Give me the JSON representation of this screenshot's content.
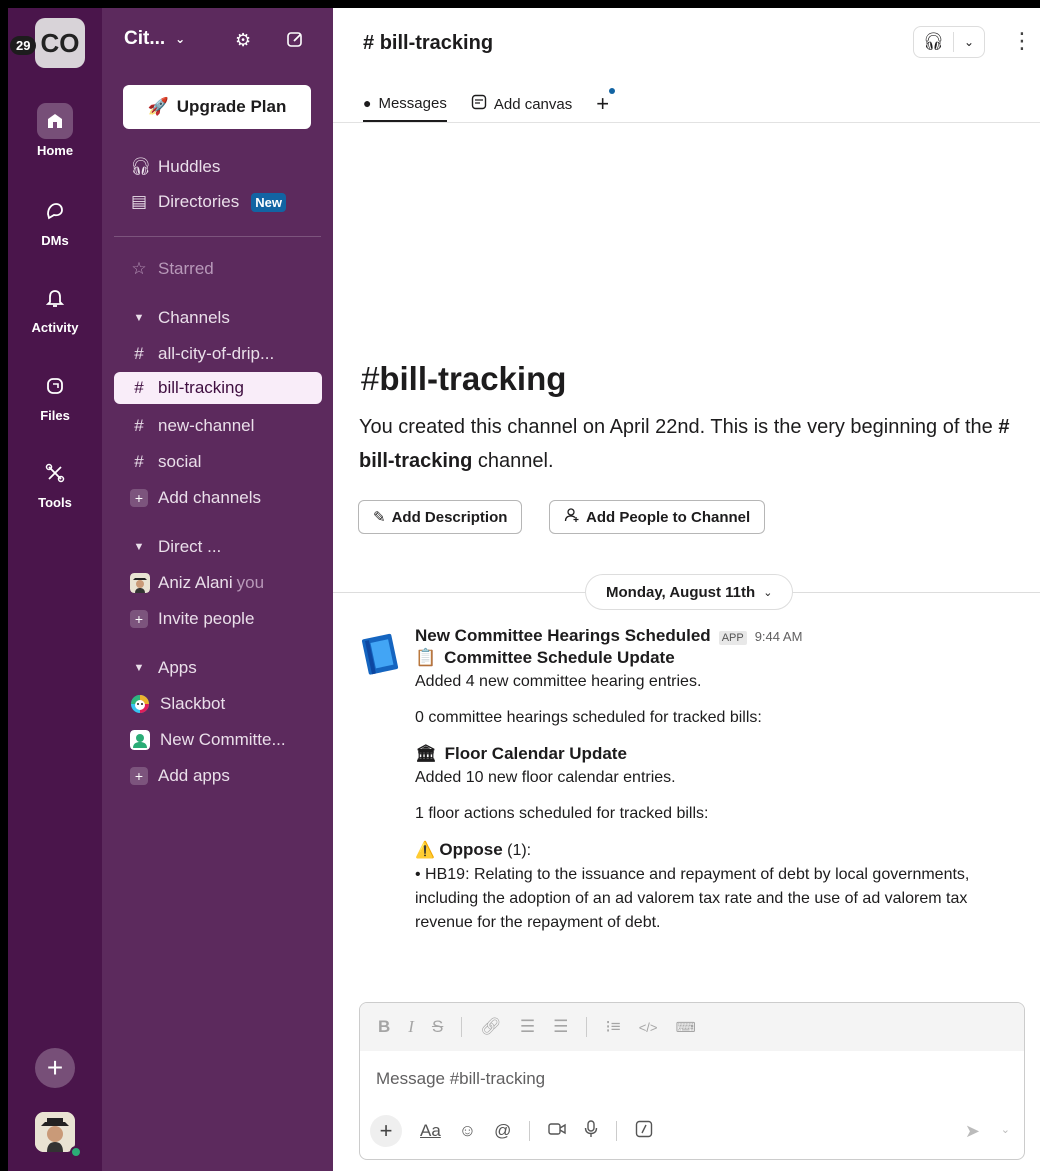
{
  "rail": {
    "workspace_initials": "CO",
    "badge_count": "29",
    "items": [
      {
        "label": "Home"
      },
      {
        "label": "DMs"
      },
      {
        "label": "Activity"
      },
      {
        "label": "Files"
      },
      {
        "label": "Tools"
      }
    ]
  },
  "sidebar": {
    "workspace_name": "Cit...",
    "upgrade_label": "Upgrade Plan",
    "huddles": "Huddles",
    "directories": "Directories",
    "new_badge": "New",
    "starred": "Starred",
    "channels_header": "Channels",
    "channels": [
      "all-city-of-drip...",
      "bill-tracking",
      "new-channel",
      "social"
    ],
    "add_channels": "Add channels",
    "direct_header": "Direct ...",
    "dm_user": "Aniz Alani",
    "dm_you": "you",
    "invite_people": "Invite people",
    "apps_header": "Apps",
    "apps": [
      "Slackbot",
      "New Committe..."
    ],
    "add_apps": "Add apps"
  },
  "main": {
    "channel_title": "bill-tracking",
    "tabs": {
      "messages": "Messages",
      "add_canvas": "Add canvas"
    },
    "intro": {
      "title": "bill-tracking",
      "text_before": "You created this channel on April 22nd. This is the very beginning of the ",
      "channel_bold": "bill-tracking",
      "text_after": " channel.",
      "add_description": "Add Description",
      "add_people": "Add People to Channel"
    },
    "date_divider": "Monday, August 11th",
    "message": {
      "sender": "New Committee Hearings Scheduled",
      "app_badge": "APP",
      "time": "9:44 AM",
      "committee_heading": "Committee Schedule Update",
      "committee_added": "Added 4 new committee hearing entries.",
      "committee_tracked": "0 committee hearings scheduled for tracked bills:",
      "floor_heading": "Floor Calendar Update",
      "floor_added": "Added 10 new floor calendar entries.",
      "floor_tracked": "1 floor actions scheduled for tracked bills:",
      "oppose_label": "Oppose",
      "oppose_count": " (1):",
      "bill_line": "• HB19: Relating to the issuance and repayment of debt by local governments, including the adoption of an ad valorem tax rate and the use of ad valorem tax revenue for the repayment of debt."
    },
    "composer": {
      "placeholder": "Message #bill-tracking"
    }
  },
  "colors": {
    "rail_bg": "#4a154b",
    "sidebar_bg": "#5c2a5d",
    "active_channel_bg": "#f9edf9",
    "new_badge": "#1264a3",
    "presence": "#2bac76"
  }
}
